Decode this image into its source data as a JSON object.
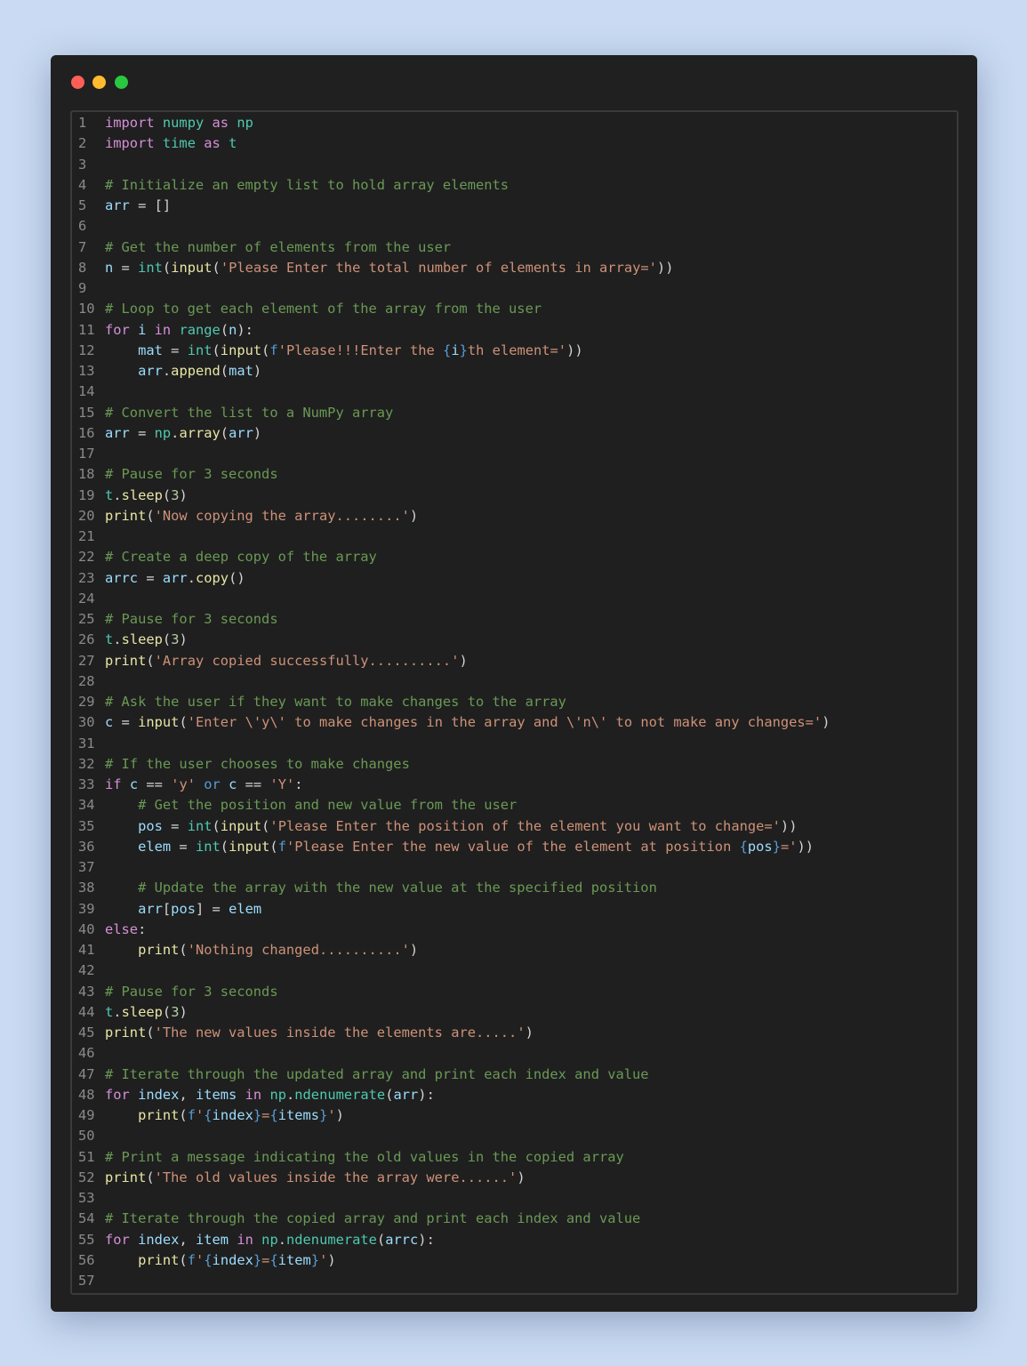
{
  "window": {
    "controls": [
      "close",
      "minimize",
      "maximize"
    ]
  },
  "colors": {
    "keyword": "#d68fd8",
    "module": "#4ec9b0",
    "variable": "#9cdcfe",
    "function": "#e8e6a6",
    "string": "#ce9178",
    "comment": "#6a9955",
    "number": "#b5cea8"
  },
  "editor": {
    "lines": [
      [
        [
          "kw",
          "import"
        ],
        [
          "p",
          " "
        ],
        [
          "mod",
          "numpy"
        ],
        [
          "p",
          " "
        ],
        [
          "kw",
          "as"
        ],
        [
          "p",
          " "
        ],
        [
          "mod",
          "np"
        ]
      ],
      [
        [
          "kw",
          "import"
        ],
        [
          "p",
          " "
        ],
        [
          "mod",
          "time"
        ],
        [
          "p",
          " "
        ],
        [
          "kw",
          "as"
        ],
        [
          "p",
          " "
        ],
        [
          "mod",
          "t"
        ]
      ],
      [],
      [
        [
          "com",
          "# Initialize an empty list to hold array elements"
        ]
      ],
      [
        [
          "var",
          "arr"
        ],
        [
          "p",
          " = []"
        ]
      ],
      [],
      [
        [
          "com",
          "# Get the number of elements from the user"
        ]
      ],
      [
        [
          "var",
          "n"
        ],
        [
          "p",
          " = "
        ],
        [
          "bi",
          "int"
        ],
        [
          "p",
          "("
        ],
        [
          "fn",
          "input"
        ],
        [
          "p",
          "("
        ],
        [
          "str",
          "'Please Enter the total number of elements in array='"
        ],
        [
          "p",
          "))"
        ]
      ],
      [],
      [
        [
          "com",
          "# Loop to get each element of the array from the user"
        ]
      ],
      [
        [
          "kw",
          "for"
        ],
        [
          "p",
          " "
        ],
        [
          "var",
          "i"
        ],
        [
          "p",
          " "
        ],
        [
          "kw",
          "in"
        ],
        [
          "p",
          " "
        ],
        [
          "bi",
          "range"
        ],
        [
          "p",
          "("
        ],
        [
          "var",
          "n"
        ],
        [
          "p",
          "):"
        ]
      ],
      [
        [
          "p",
          "    "
        ],
        [
          "var",
          "mat"
        ],
        [
          "p",
          " = "
        ],
        [
          "bi",
          "int"
        ],
        [
          "p",
          "("
        ],
        [
          "fn",
          "input"
        ],
        [
          "p",
          "("
        ],
        [
          "fi",
          "f"
        ],
        [
          "str",
          "'Please!!!Enter the "
        ],
        [
          "fi",
          "{"
        ],
        [
          "var",
          "i"
        ],
        [
          "fi",
          "}"
        ],
        [
          "str",
          "th element='"
        ],
        [
          "p",
          "))"
        ]
      ],
      [
        [
          "p",
          "    "
        ],
        [
          "var",
          "arr"
        ],
        [
          "p",
          "."
        ],
        [
          "fn",
          "append"
        ],
        [
          "p",
          "("
        ],
        [
          "var",
          "mat"
        ],
        [
          "p",
          ")"
        ]
      ],
      [],
      [
        [
          "com",
          "# Convert the list to a NumPy array"
        ]
      ],
      [
        [
          "var",
          "arr"
        ],
        [
          "p",
          " = "
        ],
        [
          "mod",
          "np"
        ],
        [
          "p",
          "."
        ],
        [
          "fn",
          "array"
        ],
        [
          "p",
          "("
        ],
        [
          "var",
          "arr"
        ],
        [
          "p",
          ")"
        ]
      ],
      [],
      [
        [
          "com",
          "# Pause for 3 seconds"
        ]
      ],
      [
        [
          "mod",
          "t"
        ],
        [
          "p",
          "."
        ],
        [
          "fn",
          "sleep"
        ],
        [
          "p",
          "("
        ],
        [
          "num",
          "3"
        ],
        [
          "p",
          ")"
        ]
      ],
      [
        [
          "fn",
          "print"
        ],
        [
          "p",
          "("
        ],
        [
          "str",
          "'Now copying the array........'"
        ],
        [
          "p",
          ")"
        ]
      ],
      [],
      [
        [
          "com",
          "# Create a deep copy of the array"
        ]
      ],
      [
        [
          "var",
          "arrc"
        ],
        [
          "p",
          " = "
        ],
        [
          "var",
          "arr"
        ],
        [
          "p",
          "."
        ],
        [
          "fn",
          "copy"
        ],
        [
          "p",
          "()"
        ]
      ],
      [],
      [
        [
          "com",
          "# Pause for 3 seconds"
        ]
      ],
      [
        [
          "mod",
          "t"
        ],
        [
          "p",
          "."
        ],
        [
          "fn",
          "sleep"
        ],
        [
          "p",
          "("
        ],
        [
          "num",
          "3"
        ],
        [
          "p",
          ")"
        ]
      ],
      [
        [
          "fn",
          "print"
        ],
        [
          "p",
          "("
        ],
        [
          "str",
          "'Array copied successfully..........'"
        ],
        [
          "p",
          ")"
        ]
      ],
      [],
      [
        [
          "com",
          "# Ask the user if they want to make changes to the array"
        ]
      ],
      [
        [
          "var",
          "c"
        ],
        [
          "p",
          " = "
        ],
        [
          "fn",
          "input"
        ],
        [
          "p",
          "("
        ],
        [
          "str",
          "'Enter \\'y\\' to make changes in the array and \\'n\\' to not make any changes='"
        ],
        [
          "p",
          ")"
        ]
      ],
      [],
      [
        [
          "com",
          "# If the user chooses to make changes"
        ]
      ],
      [
        [
          "kw",
          "if"
        ],
        [
          "p",
          " "
        ],
        [
          "var",
          "c"
        ],
        [
          "p",
          " == "
        ],
        [
          "str",
          "'y'"
        ],
        [
          "p",
          " "
        ],
        [
          "fi",
          "or"
        ],
        [
          "p",
          " "
        ],
        [
          "var",
          "c"
        ],
        [
          "p",
          " == "
        ],
        [
          "str",
          "'Y'"
        ],
        [
          "p",
          ":"
        ]
      ],
      [
        [
          "p",
          "    "
        ],
        [
          "com",
          "# Get the position and new value from the user"
        ]
      ],
      [
        [
          "p",
          "    "
        ],
        [
          "var",
          "pos"
        ],
        [
          "p",
          " = "
        ],
        [
          "bi",
          "int"
        ],
        [
          "p",
          "("
        ],
        [
          "fn",
          "input"
        ],
        [
          "p",
          "("
        ],
        [
          "str",
          "'Please Enter the position of the element you want to change='"
        ],
        [
          "p",
          "))"
        ]
      ],
      [
        [
          "p",
          "    "
        ],
        [
          "var",
          "elem"
        ],
        [
          "p",
          " = "
        ],
        [
          "bi",
          "int"
        ],
        [
          "p",
          "("
        ],
        [
          "fn",
          "input"
        ],
        [
          "p",
          "("
        ],
        [
          "fi",
          "f"
        ],
        [
          "str",
          "'Please Enter the new value of the element at position "
        ],
        [
          "fi",
          "{"
        ],
        [
          "var",
          "pos"
        ],
        [
          "fi",
          "}"
        ],
        [
          "str",
          "='"
        ],
        [
          "p",
          "))"
        ]
      ],
      [],
      [
        [
          "p",
          "    "
        ],
        [
          "com",
          "# Update the array with the new value at the specified position"
        ]
      ],
      [
        [
          "p",
          "    "
        ],
        [
          "var",
          "arr"
        ],
        [
          "p",
          "["
        ],
        [
          "var",
          "pos"
        ],
        [
          "p",
          "] = "
        ],
        [
          "var",
          "elem"
        ]
      ],
      [
        [
          "kw",
          "else"
        ],
        [
          "p",
          ":"
        ]
      ],
      [
        [
          "p",
          "    "
        ],
        [
          "fn",
          "print"
        ],
        [
          "p",
          "("
        ],
        [
          "str",
          "'Nothing changed..........'"
        ],
        [
          "p",
          ")"
        ]
      ],
      [],
      [
        [
          "com",
          "# Pause for 3 seconds"
        ]
      ],
      [
        [
          "mod",
          "t"
        ],
        [
          "p",
          "."
        ],
        [
          "fn",
          "sleep"
        ],
        [
          "p",
          "("
        ],
        [
          "num",
          "3"
        ],
        [
          "p",
          ")"
        ]
      ],
      [
        [
          "fn",
          "print"
        ],
        [
          "p",
          "("
        ],
        [
          "str",
          "'The new values inside the elements are.....'"
        ],
        [
          "p",
          ")"
        ]
      ],
      [],
      [
        [
          "com",
          "# Iterate through the updated array and print each index and value"
        ]
      ],
      [
        [
          "kw",
          "for"
        ],
        [
          "p",
          " "
        ],
        [
          "var",
          "index"
        ],
        [
          "p",
          ", "
        ],
        [
          "var",
          "items"
        ],
        [
          "p",
          " "
        ],
        [
          "kw",
          "in"
        ],
        [
          "p",
          " "
        ],
        [
          "mod",
          "np"
        ],
        [
          "p",
          "."
        ],
        [
          "bi",
          "ndenumerate"
        ],
        [
          "p",
          "("
        ],
        [
          "var",
          "arr"
        ],
        [
          "p",
          "):"
        ]
      ],
      [
        [
          "p",
          "    "
        ],
        [
          "fn",
          "print"
        ],
        [
          "p",
          "("
        ],
        [
          "fi",
          "f"
        ],
        [
          "str",
          "'"
        ],
        [
          "fi",
          "{"
        ],
        [
          "var",
          "index"
        ],
        [
          "fi",
          "}"
        ],
        [
          "str",
          "="
        ],
        [
          "fi",
          "{"
        ],
        [
          "var",
          "items"
        ],
        [
          "fi",
          "}"
        ],
        [
          "str",
          "'"
        ],
        [
          "p",
          ")"
        ]
      ],
      [],
      [
        [
          "com",
          "# Print a message indicating the old values in the copied array"
        ]
      ],
      [
        [
          "fn",
          "print"
        ],
        [
          "p",
          "("
        ],
        [
          "str",
          "'The old values inside the array were......'"
        ],
        [
          "p",
          ")"
        ]
      ],
      [],
      [
        [
          "com",
          "# Iterate through the copied array and print each index and value"
        ]
      ],
      [
        [
          "kw",
          "for"
        ],
        [
          "p",
          " "
        ],
        [
          "var",
          "index"
        ],
        [
          "p",
          ", "
        ],
        [
          "var",
          "item"
        ],
        [
          "p",
          " "
        ],
        [
          "kw",
          "in"
        ],
        [
          "p",
          " "
        ],
        [
          "mod",
          "np"
        ],
        [
          "p",
          "."
        ],
        [
          "bi",
          "ndenumerate"
        ],
        [
          "p",
          "("
        ],
        [
          "var",
          "arrc"
        ],
        [
          "p",
          "):"
        ]
      ],
      [
        [
          "p",
          "    "
        ],
        [
          "fn",
          "print"
        ],
        [
          "p",
          "("
        ],
        [
          "fi",
          "f"
        ],
        [
          "str",
          "'"
        ],
        [
          "fi",
          "{"
        ],
        [
          "var",
          "index"
        ],
        [
          "fi",
          "}"
        ],
        [
          "str",
          "="
        ],
        [
          "fi",
          "{"
        ],
        [
          "var",
          "item"
        ],
        [
          "fi",
          "}"
        ],
        [
          "str",
          "'"
        ],
        [
          "p",
          ")"
        ]
      ],
      []
    ]
  }
}
